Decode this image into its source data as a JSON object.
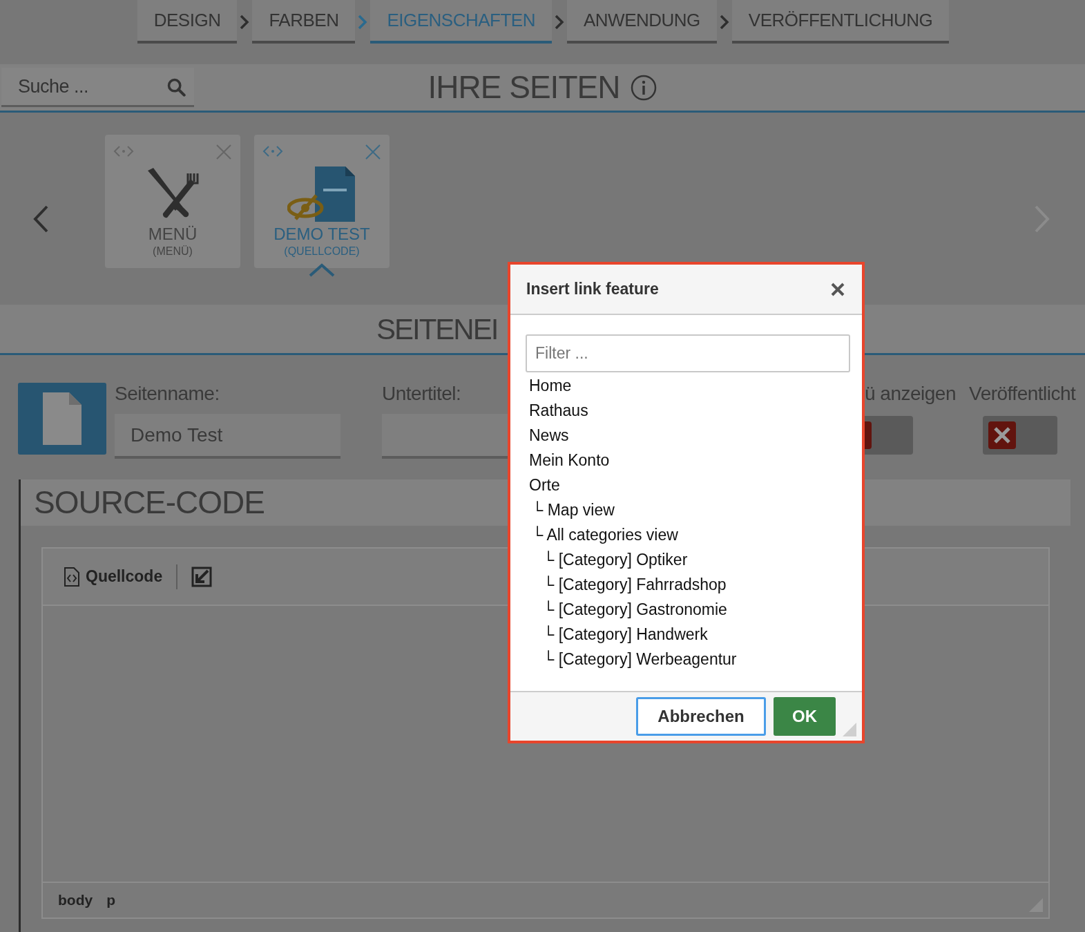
{
  "steps": [
    {
      "label": "DESIGN",
      "selected": false
    },
    {
      "label": "FARBEN",
      "selected": false
    },
    {
      "label": "EIGENSCHAFTEN",
      "selected": true
    },
    {
      "label": "ANWENDUNG",
      "selected": false
    },
    {
      "label": "VERÖFFENTLICHUNG",
      "selected": false
    }
  ],
  "search": {
    "placeholder": "Suche ..."
  },
  "pages_header": {
    "title": "IHRE SEITEN"
  },
  "pages": [
    {
      "title": "MENÜ",
      "subtitle": "(MENÜ)",
      "kind": "menu",
      "selected": false
    },
    {
      "title": "DEMO TEST",
      "subtitle": "(QUELLCODE)",
      "kind": "html",
      "selected": true
    }
  ],
  "settings_header": {
    "title": "SEITENEI"
  },
  "fields": [
    {
      "label": "Seitenname:",
      "value": "Demo Test"
    },
    {
      "label": "Untertitel:"
    }
  ],
  "toggles": [
    {
      "label": "ü anzeigen",
      "on": false
    },
    {
      "label": "Veröffentlicht",
      "on": false
    }
  ],
  "source": {
    "title": "SOURCE-CODE",
    "toolbar_label": "Quellcode",
    "path": [
      "body",
      "p"
    ]
  },
  "dialog": {
    "title": "Insert link feature",
    "filter_placeholder": "Filter ...",
    "items": [
      {
        "label": "Home"
      },
      {
        "label": "Rathaus"
      },
      {
        "label": "News"
      },
      {
        "label": "Mein Konto"
      },
      {
        "label": "Orte",
        "children": [
          {
            "prefix": "└",
            "label": "Map view"
          },
          {
            "prefix": "└",
            "label": "All categories view",
            "children": [
              {
                "prefix": "└",
                "label": "[Category] Optiker"
              },
              {
                "prefix": "└",
                "label": "[Category] Fahrradshop"
              },
              {
                "prefix": "└",
                "label": "[Category] Gastronomie"
              },
              {
                "prefix": "└",
                "label": "[Category] Handwerk"
              },
              {
                "prefix": "└",
                "label": "[Category] Werbeagentur"
              }
            ]
          }
        ]
      }
    ],
    "buttons": [
      {
        "label": "Abbrechen",
        "kind": "secondary"
      },
      {
        "label": "OK",
        "kind": "primary"
      }
    ]
  }
}
